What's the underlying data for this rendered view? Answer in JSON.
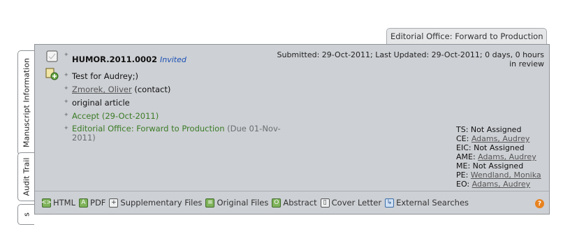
{
  "status_tab": {
    "label": "Editorial Office: Forward to Production"
  },
  "side_tabs": {
    "manuscript_information": "Manuscript Information",
    "audit_trail": "Audit Trail",
    "third": "s"
  },
  "manuscript": {
    "id": "HUMOR.2011.0002",
    "invite_status": "Invited",
    "title": "Test for Audrey;)",
    "author_name": "Zmorek, Oliver",
    "author_role": "(contact)",
    "article_type": "original article",
    "decision": "Accept (29-Oct-2011)",
    "current_stage": "Editorial Office: Forward to Production",
    "current_stage_due": "(Due 01-Nov-2011)"
  },
  "submission": {
    "line1": "Submitted: 29-Oct-2011; Last Updated: 29-Oct-2011; 0 days, 0 hours",
    "line2": "in review"
  },
  "roles": [
    {
      "role": "TS:",
      "value": "Not Assigned",
      "link": false
    },
    {
      "role": "CE:",
      "value": "Adams, Audrey",
      "link": true
    },
    {
      "role": "EIC:",
      "value": "Not Assigned",
      "link": false
    },
    {
      "role": "AME:",
      "value": "Adams, Audrey",
      "link": true
    },
    {
      "role": "ME:",
      "value": "Not Assigned",
      "link": false
    },
    {
      "role": "PE:",
      "value": "Wendland, Monika",
      "link": true
    },
    {
      "role": "EO:",
      "value": "Adams, Audrey",
      "link": true
    }
  ],
  "toolbar": {
    "html": "HTML",
    "pdf": "PDF",
    "supplementary": "Supplementary Files",
    "original": "Original Files",
    "abstract": "Abstract",
    "cover_letter": "Cover Letter",
    "external_searches": "External Searches",
    "help": "?"
  },
  "colors": {
    "panel": "#cdd0d4",
    "green_text": "#3b7b27",
    "invited_blue": "#1a4fb5",
    "help_orange": "#e8821e"
  }
}
